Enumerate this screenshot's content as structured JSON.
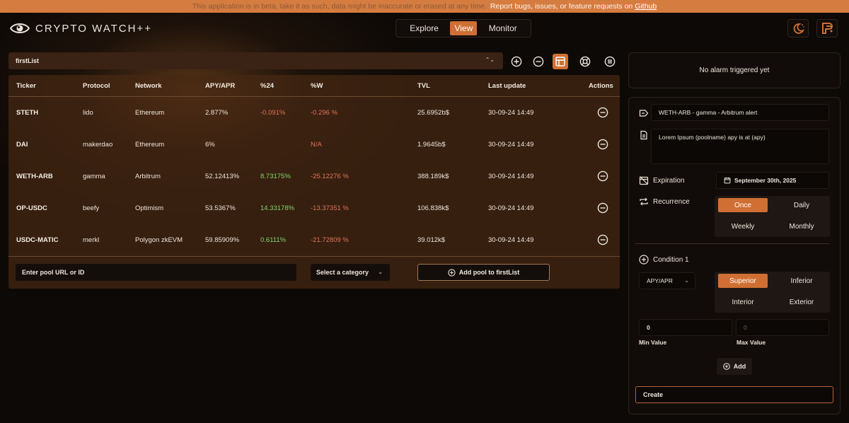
{
  "banner": {
    "message": "This application is in beta, take it as such, data might be inaccurate or erased at any time.",
    "link_text": "Report bugs, issues, or feature requests on",
    "link": "Github"
  },
  "header": {
    "app_name": "CRYPTO WATCH++",
    "tabs": [
      {
        "label": "Explore",
        "active": false
      },
      {
        "label": "View",
        "active": true
      },
      {
        "label": "Monitor",
        "active": false
      }
    ]
  },
  "list": {
    "selected": "firstList"
  },
  "table": {
    "columns": [
      "Ticker",
      "Protocol",
      "Network",
      "APY/APR",
      "%24",
      "%W",
      "TVL",
      "Last update",
      "Actions"
    ],
    "rows": [
      {
        "ticker": "STETH",
        "protocol": "lido",
        "network": "Ethereum",
        "apy": "2.877%",
        "d24": "-0.091%",
        "d24_sign": "neg",
        "w": "-0.296 %",
        "w_sign": "neg",
        "tvl": "25.6952b$",
        "updated": "30-09-24 14:49"
      },
      {
        "ticker": "DAI",
        "protocol": "makerdao",
        "network": "Ethereum",
        "apy": "6%",
        "d24": "",
        "d24_sign": "",
        "w": "N/A",
        "w_sign": "neg",
        "tvl": "1.9645b$",
        "updated": "30-09-24 14:49"
      },
      {
        "ticker": "WETH-ARB",
        "protocol": "gamma",
        "network": "Arbitrum",
        "apy": "52.12413%",
        "d24": "8.73175%",
        "d24_sign": "pos",
        "w": "-25.12276 %",
        "w_sign": "neg",
        "tvl": "388.189k$",
        "updated": "30-09-24 14:49"
      },
      {
        "ticker": "OP-USDC",
        "protocol": "beefy",
        "network": "Optimism",
        "apy": "53.5367%",
        "d24": "14.33178%",
        "d24_sign": "pos",
        "w": "-13.37351 %",
        "w_sign": "neg",
        "tvl": "106.838k$",
        "updated": "30-09-24 14:49"
      },
      {
        "ticker": "USDC-MATIC",
        "protocol": "merkl",
        "network": "Polygon zkEVM",
        "apy": "59.85909%",
        "d24": "0.6111%",
        "d24_sign": "pos",
        "w": "-21.72809 %",
        "w_sign": "neg",
        "tvl": "39.012k$",
        "updated": "30-09-24 14:49"
      }
    ]
  },
  "add_pool": {
    "input_placeholder": "Enter pool URL or ID",
    "category_placeholder": "Select a category",
    "button_label": "Add pool to firstList"
  },
  "alarm": {
    "status": "No alarm triggered yet",
    "name": "WETH-ARB - gamma - Arbitrum alert",
    "message": "Lorem Ipsum (poolname) apy is at (apy)",
    "expiration_label": "Expiration",
    "expiration_date": "September 30th, 2025",
    "recurrence_label": "Recurrence",
    "recurrence_options": [
      {
        "label": "Once",
        "active": true
      },
      {
        "label": "Daily",
        "active": false
      },
      {
        "label": "Weekly",
        "active": false
      },
      {
        "label": "Monthly",
        "active": false
      }
    ],
    "condition_label": "Condition 1",
    "metric": "APY/APR",
    "condition_options": [
      {
        "label": "Superior",
        "active": true
      },
      {
        "label": "Inferior",
        "active": false
      },
      {
        "label": "Interior",
        "active": false
      },
      {
        "label": "Exterior",
        "active": false
      }
    ],
    "min_value": "0",
    "max_value": "0",
    "min_label": "Min Value",
    "max_label": "Max Value",
    "add_label": "Add",
    "create_label": "Create"
  },
  "colors": {
    "accent": "#d06f33",
    "banner": "#d57c40",
    "positive": "#7bd96b",
    "negative": "#e2735b"
  }
}
